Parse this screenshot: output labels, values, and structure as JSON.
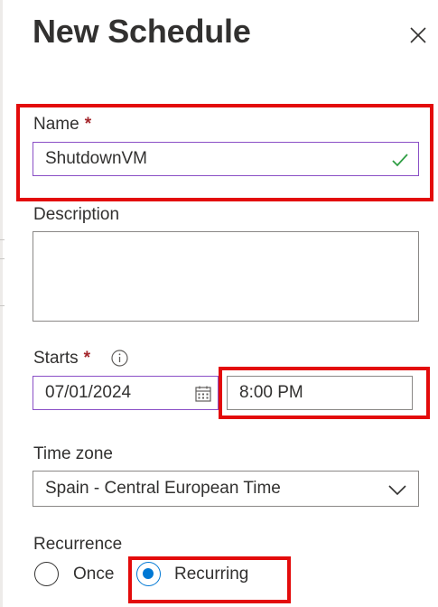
{
  "panel": {
    "title": "New Schedule",
    "close_icon": "close-icon"
  },
  "name": {
    "label": "Name",
    "required_marker": "*",
    "value": "ShutdownVM",
    "valid_icon": "checkmark-icon"
  },
  "description": {
    "label": "Description",
    "value": ""
  },
  "starts": {
    "label": "Starts",
    "required_marker": "*",
    "info_icon": "info-icon",
    "date_value": "07/01/2024",
    "calendar_icon": "calendar-icon",
    "time_value": "8:00 PM"
  },
  "time_zone": {
    "label": "Time zone",
    "selected": "Spain - Central European Time",
    "dropdown_icon": "chevron-down-icon"
  },
  "recurrence": {
    "label": "Recurrence",
    "options": [
      {
        "label": "Once",
        "selected": false
      },
      {
        "label": "Recurring",
        "selected": true
      }
    ]
  },
  "colors": {
    "highlight": "#e30b0b",
    "focus_border": "#8a4fc6",
    "required": "#a4262c",
    "radio_selected": "#0078d4",
    "valid_check": "#2f9e44"
  }
}
